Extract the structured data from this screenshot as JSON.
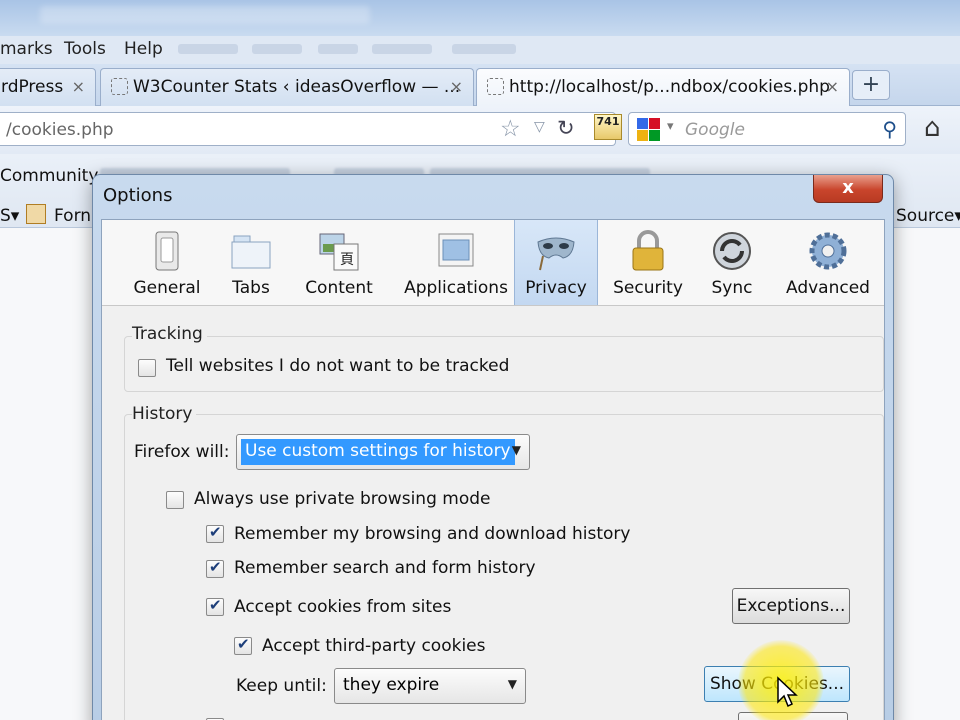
{
  "browser": {
    "menu": {
      "bookmarks": "marks",
      "tools": "Tools",
      "help": "Help"
    },
    "tabs": [
      {
        "label": "rdPress",
        "close": "×"
      },
      {
        "label": "W3Counter Stats ‹ ideasOverflow — ...",
        "close": "×"
      },
      {
        "label": "http://localhost/p...ndbox/cookies.php",
        "close": "×"
      }
    ],
    "new_tab": "+",
    "url": "/cookies.php",
    "alexa_rank": "741",
    "search_placeholder": "Google",
    "bookmarks": {
      "community": "Community",
      "row2_left": "S",
      "forms": "Forn",
      "source": "Source"
    }
  },
  "dialog": {
    "title": "Options",
    "close": "x",
    "panes": [
      {
        "label": "General",
        "icon": "general-icon"
      },
      {
        "label": "Tabs",
        "icon": "tabs-icon"
      },
      {
        "label": "Content",
        "icon": "content-icon"
      },
      {
        "label": "Applications",
        "icon": "applications-icon"
      },
      {
        "label": "Privacy",
        "icon": "privacy-mask-icon",
        "selected": true
      },
      {
        "label": "Security",
        "icon": "padlock-icon"
      },
      {
        "label": "Sync",
        "icon": "sync-icon"
      },
      {
        "label": "Advanced",
        "icon": "gear-icon"
      }
    ],
    "tracking": {
      "heading": "Tracking",
      "do_not_track": {
        "label": "Tell websites I do not want to be tracked",
        "checked": false
      }
    },
    "history": {
      "heading": "History",
      "firefox_will_label": "Firefox will:",
      "firefox_will_value": "Use custom settings for history",
      "private_browsing": {
        "label": "Always use private browsing mode",
        "checked": false
      },
      "remember_browsing": {
        "label": "Remember my browsing and download history",
        "checked": true
      },
      "remember_search": {
        "label": "Remember search and form history",
        "checked": true
      },
      "accept_cookies": {
        "label": "Accept cookies from sites",
        "checked": true
      },
      "exceptions_button": "Exceptions...",
      "third_party": {
        "label": "Accept third-party cookies",
        "checked": true
      },
      "keep_until_label": "Keep until:",
      "keep_until_value": "they expire",
      "show_cookies_button": "Show Cookies..."
    }
  }
}
